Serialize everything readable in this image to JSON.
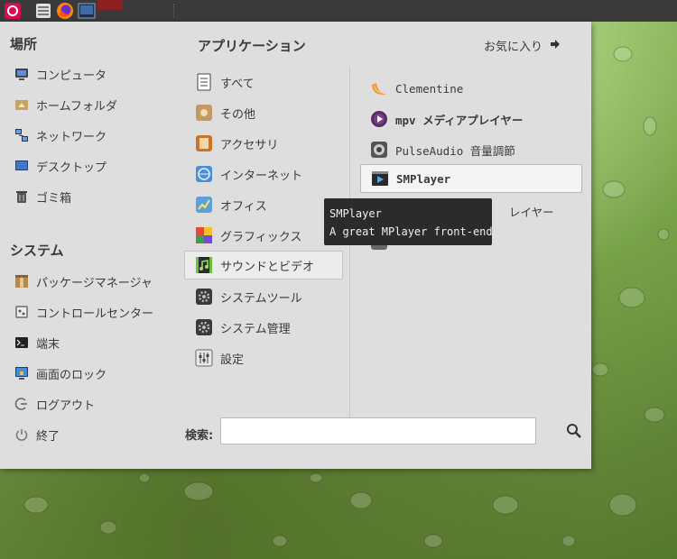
{
  "places": {
    "heading": "場所",
    "items": [
      {
        "label": "コンピュータ",
        "icon": "computer-icon"
      },
      {
        "label": "ホームフォルダ",
        "icon": "home-folder-icon"
      },
      {
        "label": "ネットワーク",
        "icon": "network-icon"
      },
      {
        "label": "デスクトップ",
        "icon": "desktop-icon"
      },
      {
        "label": "ゴミ箱",
        "icon": "trash-icon"
      }
    ]
  },
  "system": {
    "heading": "システム",
    "items": [
      {
        "label": "パッケージマネージャ",
        "icon": "package-manager-icon"
      },
      {
        "label": "コントロールセンター",
        "icon": "control-center-icon"
      },
      {
        "label": "端末",
        "icon": "terminal-icon"
      },
      {
        "label": "画面のロック",
        "icon": "lock-screen-icon"
      },
      {
        "label": "ログアウト",
        "icon": "logout-icon"
      },
      {
        "label": "終了",
        "icon": "power-icon"
      }
    ]
  },
  "applications": {
    "heading": "アプリケーション",
    "favorites_label": "お気に入り",
    "categories": [
      {
        "label": "すべて",
        "icon": "all-icon"
      },
      {
        "label": "その他",
        "icon": "other-icon"
      },
      {
        "label": "アクセサリ",
        "icon": "accessories-icon"
      },
      {
        "label": "インターネット",
        "icon": "internet-icon"
      },
      {
        "label": "オフィス",
        "icon": "office-icon"
      },
      {
        "label": "グラフィックス",
        "icon": "graphics-icon"
      },
      {
        "label": "サウンドとビデオ",
        "icon": "sound-video-icon",
        "selected": true
      },
      {
        "label": "システムツール",
        "icon": "system-tools-icon"
      },
      {
        "label": "システム管理",
        "icon": "administration-icon"
      },
      {
        "label": "設定",
        "icon": "settings-icon"
      }
    ],
    "apps": [
      {
        "label": "Clementine",
        "icon": "clementine-icon"
      },
      {
        "label": "mpv メディアプレイヤー",
        "icon": "mpv-icon",
        "bold": true
      },
      {
        "label": "PulseAudio 音量調節",
        "icon": "pulseaudio-icon"
      },
      {
        "label": "SMPlayer",
        "icon": "smplayer-icon",
        "bold": true,
        "hover": true
      },
      {
        "label": "レイヤー",
        "icon": "media-player-icon"
      },
      {
        "label": "",
        "icon": "app-icon"
      }
    ]
  },
  "search": {
    "label": "検索:",
    "value": "",
    "placeholder": ""
  },
  "tooltip": {
    "title": "SMPlayer",
    "description": "A great MPlayer front-end"
  },
  "colors": {
    "menu_bg": "#dedede",
    "panel_bg": "#3a3a3a",
    "tooltip_bg": "#2b2b2b",
    "wallpaper": "#7fa34d"
  }
}
